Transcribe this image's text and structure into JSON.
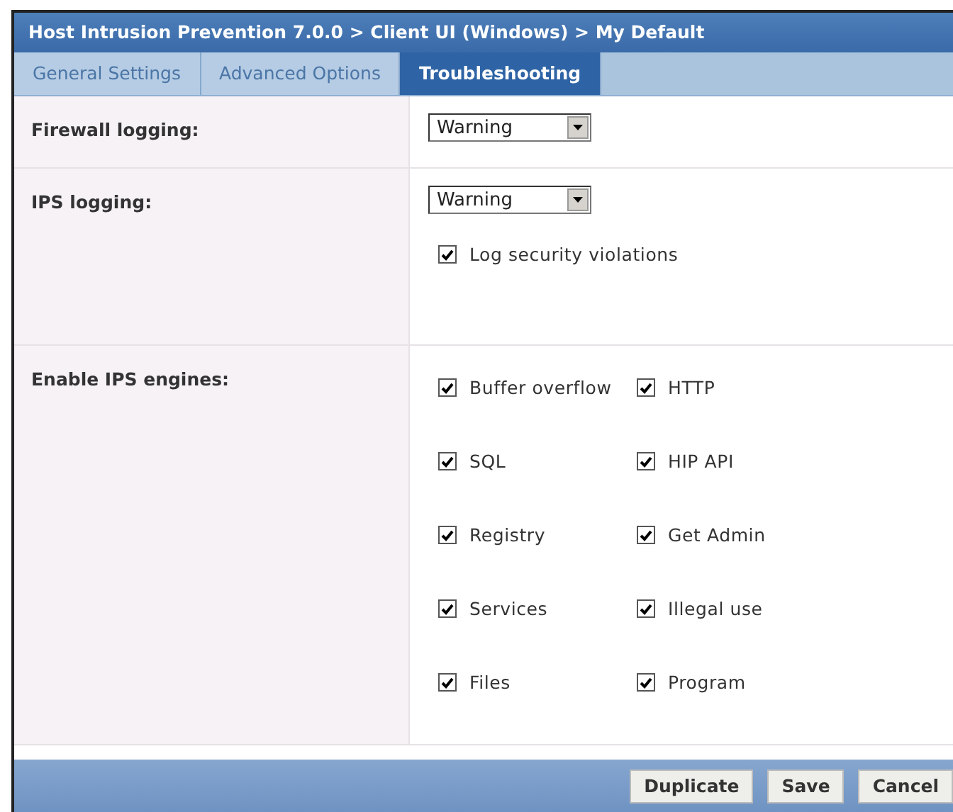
{
  "window": {
    "title": "Host Intrusion Prevention 7.0.0 > Client UI (Windows) > My Default"
  },
  "tabs": [
    {
      "label": "General Settings",
      "selected": false
    },
    {
      "label": "Advanced Options",
      "selected": false
    },
    {
      "label": "Troubleshooting",
      "selected": true
    }
  ],
  "sections": [
    {
      "label": "Firewall logging:",
      "controls": [
        {
          "kind": "select",
          "value": "Warning"
        }
      ]
    },
    {
      "label": "IPS logging:",
      "controls": [
        {
          "kind": "select",
          "value": "Warning"
        },
        {
          "kind": "checkbox",
          "label": "Log security violations",
          "checked": true
        }
      ]
    },
    {
      "label": "Enable IPS engines:",
      "controls": [
        {
          "kind": "grid",
          "items": [
            {
              "label": "Buffer overflow",
              "checked": true
            },
            {
              "label": "HTTP",
              "checked": true
            },
            {
              "label": "SQL",
              "checked": true
            },
            {
              "label": "HIP API",
              "checked": true
            },
            {
              "label": "Registry",
              "checked": true
            },
            {
              "label": "Get Admin",
              "checked": true
            },
            {
              "label": "Services",
              "checked": true
            },
            {
              "label": "Illegal use",
              "checked": true
            },
            {
              "label": "Files",
              "checked": true
            },
            {
              "label": "Program",
              "checked": true
            }
          ]
        }
      ]
    }
  ],
  "buttons": [
    "Duplicate",
    "Save",
    "Cancel"
  ]
}
